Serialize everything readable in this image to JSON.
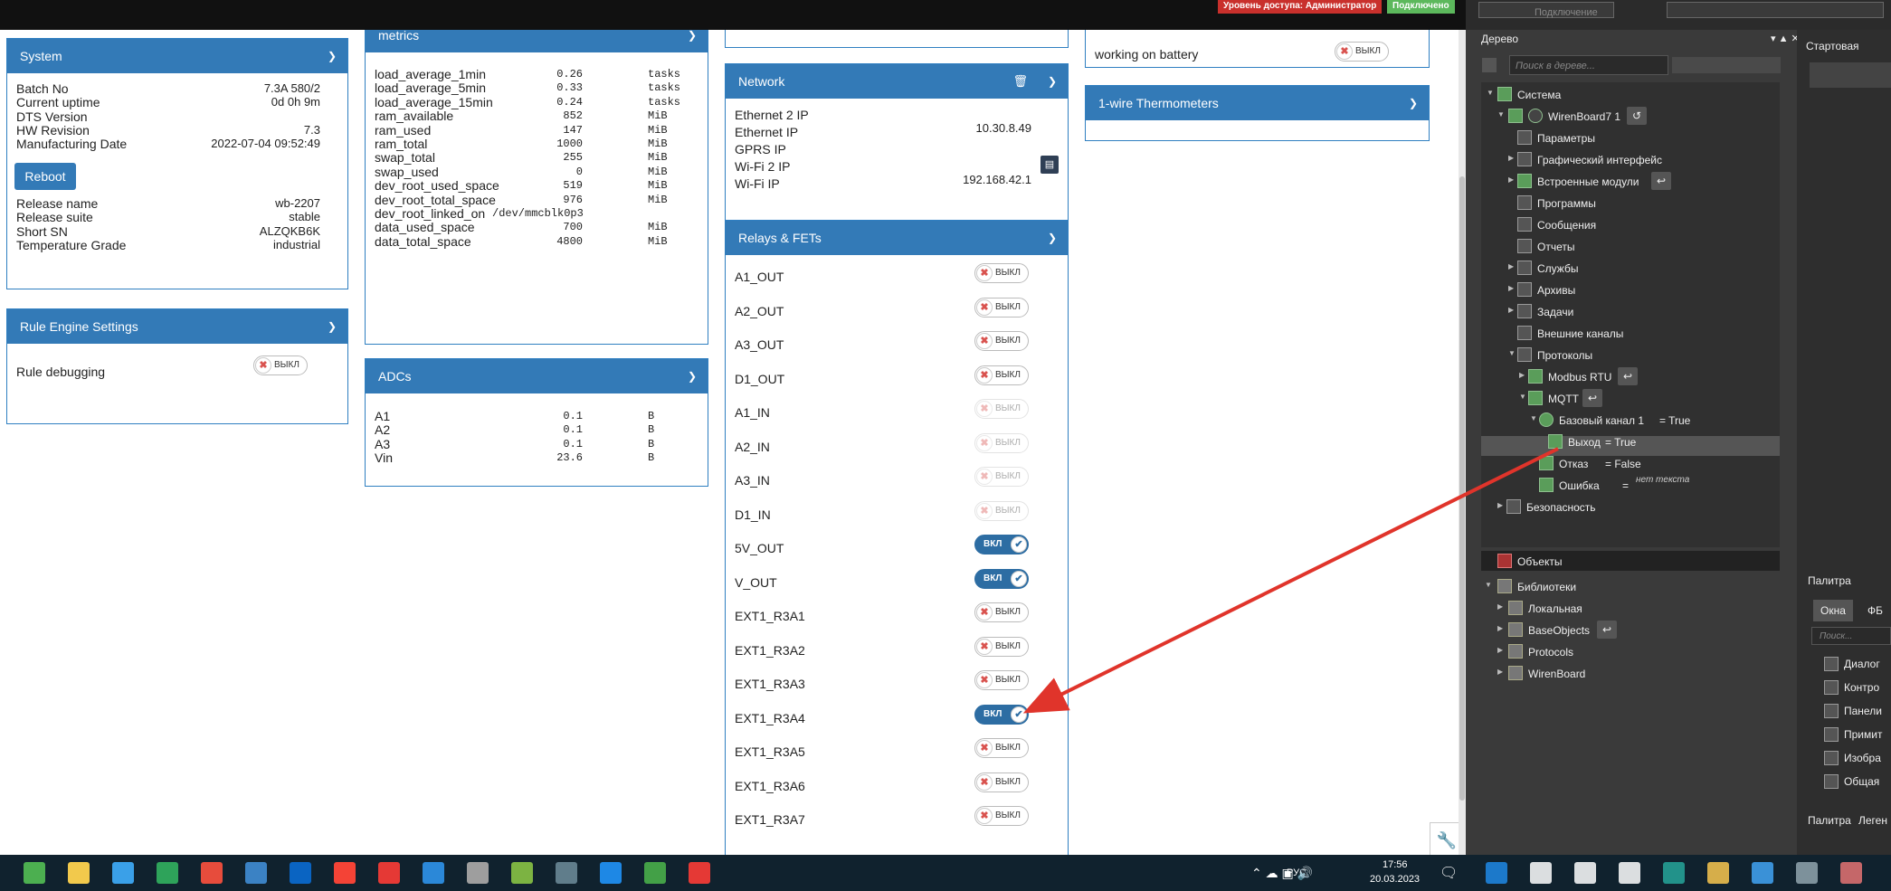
{
  "top": {
    "access_badge": "Уровень доступа: Администратор",
    "connected_badge": "Подключено",
    "connect_label": "Подключение"
  },
  "system": {
    "title": "System",
    "rows": [
      {
        "label": "Batch No",
        "value": "7.3A 580/2"
      },
      {
        "label": "Current uptime",
        "value": "0d 0h 9m"
      },
      {
        "label": "DTS Version",
        "value": ""
      },
      {
        "label": "HW Revision",
        "value": "7.3"
      },
      {
        "label": "Manufacturing Date",
        "value": "2022-07-04 09:52:49"
      }
    ],
    "reboot": "Reboot",
    "rows2": [
      {
        "label": "Release name",
        "value": "wb-2207"
      },
      {
        "label": "Release suite",
        "value": "stable"
      },
      {
        "label": "Short SN",
        "value": "ALZQKB6K"
      },
      {
        "label": "Temperature Grade",
        "value": "industrial"
      }
    ]
  },
  "rule": {
    "title": "Rule Engine Settings",
    "label": "Rule debugging",
    "toggle": "ВЫКЛ"
  },
  "metrics": {
    "title": "metrics",
    "rows": [
      {
        "label": "load_average_1min",
        "value": "0.26",
        "unit": "tasks"
      },
      {
        "label": "load_average_5min",
        "value": "0.33",
        "unit": "tasks"
      },
      {
        "label": "load_average_15min",
        "value": "0.24",
        "unit": "tasks"
      },
      {
        "label": "ram_available",
        "value": "852",
        "unit": "MiB"
      },
      {
        "label": "ram_used",
        "value": "147",
        "unit": "MiB"
      },
      {
        "label": "ram_total",
        "value": "1000",
        "unit": "MiB"
      },
      {
        "label": "swap_total",
        "value": "255",
        "unit": "MiB"
      },
      {
        "label": "swap_used",
        "value": "0",
        "unit": "MiB"
      },
      {
        "label": "dev_root_used_space",
        "value": "519",
        "unit": "MiB"
      },
      {
        "label": "dev_root_total_space",
        "value": "976",
        "unit": "MiB"
      },
      {
        "label": "dev_root_linked_on",
        "value": "/dev/mmcblk0p3",
        "unit": ""
      },
      {
        "label": "data_used_space",
        "value": "700",
        "unit": "MiB"
      },
      {
        "label": "data_total_space",
        "value": "4800",
        "unit": "MiB"
      }
    ]
  },
  "adcs": {
    "title": "ADCs",
    "rows": [
      {
        "label": "A1",
        "value": "0.1",
        "unit": "B"
      },
      {
        "label": "A2",
        "value": "0.1",
        "unit": "B"
      },
      {
        "label": "A3",
        "value": "0.1",
        "unit": "B"
      },
      {
        "label": "Vin",
        "value": "23.6",
        "unit": "B"
      }
    ]
  },
  "network": {
    "title": "Network",
    "rows": [
      {
        "label": "Ethernet 2 IP",
        "value": ""
      },
      {
        "label": "Ethernet IP",
        "value": "10.30.8.49"
      },
      {
        "label": "GPRS IP",
        "value": ""
      },
      {
        "label": "Wi-Fi 2 IP",
        "value": ""
      },
      {
        "label": "Wi-Fi IP",
        "value": "192.168.42.1"
      }
    ]
  },
  "relays": {
    "title": "Relays & FETs",
    "rows": [
      {
        "label": "A1_OUT",
        "state": "ВЫКЛ"
      },
      {
        "label": "A2_OUT",
        "state": "ВЫКЛ"
      },
      {
        "label": "A3_OUT",
        "state": "ВЫКЛ"
      },
      {
        "label": "D1_OUT",
        "state": "ВЫКЛ"
      },
      {
        "label": "A1_IN",
        "state": "ВЫКЛ"
      },
      {
        "label": "A2_IN",
        "state": "ВЫКЛ"
      },
      {
        "label": "A3_IN",
        "state": "ВЫКЛ"
      },
      {
        "label": "D1_IN",
        "state": "ВЫКЛ"
      },
      {
        "label": "5V_OUT",
        "state": "ВКЛ"
      },
      {
        "label": "V_OUT",
        "state": "ВКЛ"
      },
      {
        "label": "EXT1_R3A1",
        "state": "ВЫКЛ"
      },
      {
        "label": "EXT1_R3A2",
        "state": "ВЫКЛ"
      },
      {
        "label": "EXT1_R3A3",
        "state": "ВЫКЛ"
      },
      {
        "label": "EXT1_R3A4",
        "state": "ВКЛ"
      },
      {
        "label": "EXT1_R3A5",
        "state": "ВЫКЛ"
      },
      {
        "label": "EXT1_R3A6",
        "state": "ВЫКЛ"
      },
      {
        "label": "EXT1_R3A7",
        "state": "ВЫКЛ"
      }
    ]
  },
  "battery": {
    "label": "working on battery",
    "toggle": "ВЫКЛ"
  },
  "wire": {
    "title": "1-wire Thermometers"
  },
  "tree": {
    "title": "Дерево",
    "search_placeholder": "Поиск в дереве...",
    "nodes": [
      {
        "label": "Система"
      },
      {
        "label": "WirenBoard7 1"
      },
      {
        "label": "Параметры"
      },
      {
        "label": "Графический интерфейс"
      },
      {
        "label": "Встроенные модули"
      },
      {
        "label": "Программы"
      },
      {
        "label": "Сообщения"
      },
      {
        "label": "Отчеты"
      },
      {
        "label": "Службы"
      },
      {
        "label": "Архивы"
      },
      {
        "label": "Задачи"
      },
      {
        "label": "Внешние каналы"
      },
      {
        "label": "Протоколы"
      },
      {
        "label": "Modbus RTU"
      },
      {
        "label": "MQTT"
      }
    ],
    "channel": {
      "label": "Базовый канал 1",
      "value": "= True"
    },
    "out": {
      "label": "Выход",
      "value": "= True"
    },
    "fail": {
      "label": "Отказ",
      "value": "= False"
    },
    "err": {
      "label": "Ошибка",
      "value": "=",
      "note": "нет текста"
    },
    "security": "Безопасность",
    "objects": "Объекты",
    "libs": "Библиотеки",
    "lib_items": [
      "Локальная",
      "BaseObjects",
      "Protocols",
      "WirenBoard"
    ]
  },
  "rightcol": {
    "start_tab": "Стартовая",
    "palette": "Палитра",
    "tabs": [
      "Окна",
      "ФБ"
    ],
    "search": "Поиск...",
    "items": [
      "Диалог",
      "Контро",
      "Панели",
      "Примит",
      "Изобра",
      "Общая"
    ],
    "bottom_tabs": [
      "Палитра",
      "Леген"
    ]
  },
  "taskbar": {
    "lang": "РУС",
    "time": "17:56",
    "date": "20.03.2023"
  },
  "colors": {
    "accent": "#337ab7",
    "arrow": "#e0342b"
  }
}
